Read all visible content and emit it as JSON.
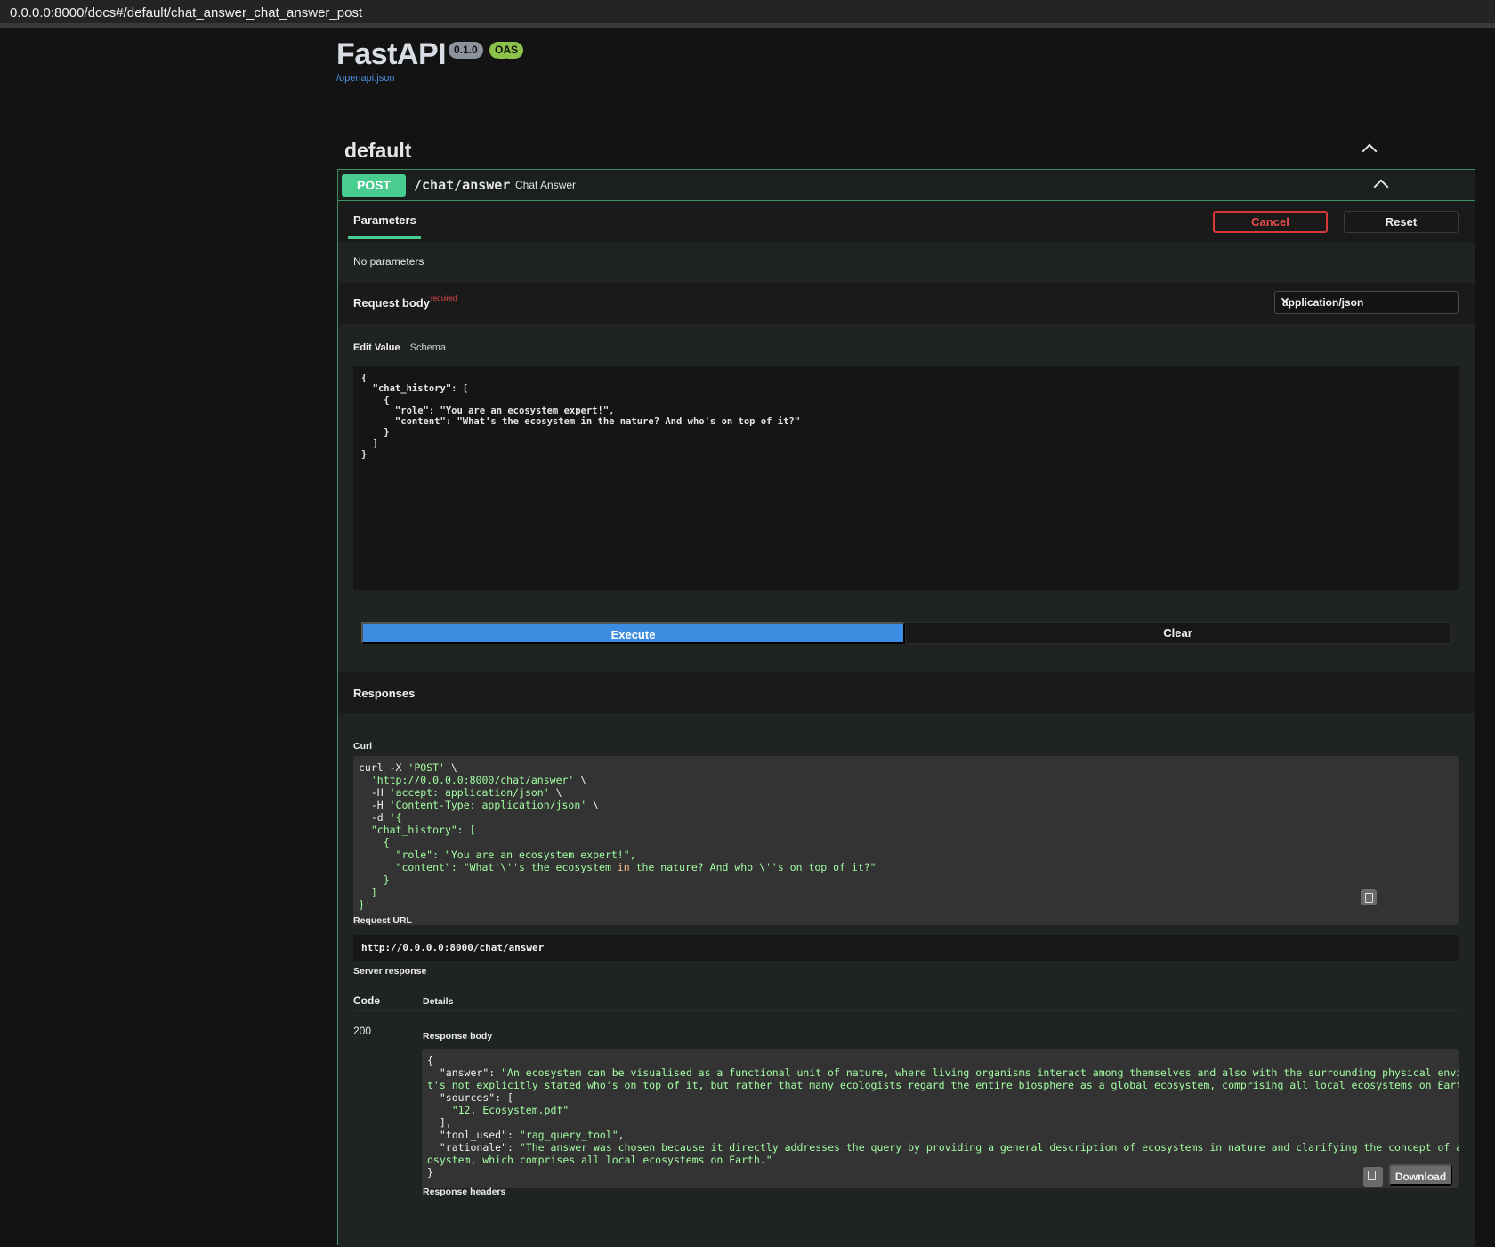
{
  "browser": {
    "url": "0.0.0.0:8000/docs#/default/chat_answer_chat_answer_post"
  },
  "header": {
    "title": "FastAPI",
    "version_badge": "0.1.0",
    "oas_badge": "OAS 3.1",
    "openapi_link": "/openapi.json"
  },
  "section": {
    "title": "default"
  },
  "operation": {
    "method": "POST",
    "path": "/chat/answer",
    "summary": "Chat Answer",
    "tab_label": "Parameters",
    "cancel_label": "Cancel",
    "reset_label": "Reset",
    "no_params": "No parameters",
    "request_body_label": "Request body",
    "required_label": "required",
    "content_type": "application/json",
    "edit_value_tab": "Edit Value",
    "schema_tab": "Schema",
    "request_json": "{\n  \"chat_history\": [\n    {\n      \"role\": \"You are an ecosystem expert!\",\n      \"content\": \"What's the ecosystem in the nature? And who's on top of it?\"\n    }\n  ]\n}",
    "execute_label": "Execute",
    "clear_label": "Clear"
  },
  "responses": {
    "title": "Responses",
    "curl_label": "Curl",
    "request_url_label": "Request URL",
    "request_url": "http://0.0.0.0:8000/chat/answer",
    "server_response_label": "Server response",
    "code_col": "Code",
    "details_col": "Details",
    "status_code": "200",
    "response_body_label": "Response body",
    "download_label": "Download",
    "response_headers_label": "Response headers"
  },
  "curl_lines": {
    "l1a": "curl -X ",
    "l1b": "'POST'",
    "l1c": " \\",
    "l2a": "'http://0.0.0.0:8000/chat/answer'",
    "l2b": " \\",
    "l3a": "-H ",
    "l3b": "'accept: application/json'",
    "l3c": " \\",
    "l4a": "-H ",
    "l4b": "'Content-Type: application/json'",
    "l4c": " \\",
    "l5a": "-d ",
    "l5b": "'{",
    "l6": "\"chat_history\": [",
    "l7": "{",
    "l8": "\"role\": \"You are an ecosystem expert!\",",
    "l9a": "\"content\": \"What'\\''s the ecosystem ",
    "l9b": "in",
    "l9c": " the nature? And who'\\''s on top of it?\"",
    "l10": "}",
    "l11": "]",
    "l12": "}'"
  },
  "response_json": {
    "open": "{",
    "answer_key": "\"answer\"",
    "answer_value": "\"An ecosystem can be visualised as a functional unit of nature, where living organisms interact among themselves and also with the surrounding physical environment. I",
    "answer_value_2": "t's not explicitly stated who's on top of it, but rather that many ecologists regard the entire biosphere as a global ecosystem, comprising all local ecosystems on Earth.\",",
    "sources_key": "\"sources\"",
    "source_1": "\"12. Ecosystem.pdf\"",
    "tool_key": "\"tool_used\"",
    "tool_value": "\"rag_query_tool\"",
    "rationale_key": "\"rationale\"",
    "rationale_value": "\"The answer was chosen because it directly addresses the query by providing a general description of ecosystems in nature and clarifying the concept of a global ec",
    "rationale_value_2": "osystem, which comprises all local ecosystems on Earth.\"",
    "close": "}"
  }
}
